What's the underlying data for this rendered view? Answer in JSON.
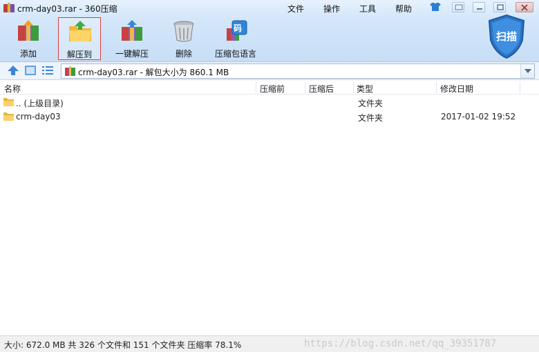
{
  "window": {
    "title": "crm-day03.rar - 360压缩"
  },
  "menu": [
    "文件",
    "操作",
    "工具",
    "帮助"
  ],
  "toolbar": {
    "items": [
      {
        "label": "添加",
        "icon": "add-archive-icon"
      },
      {
        "label": "解压到",
        "icon": "extract-to-icon",
        "selected": true
      },
      {
        "label": "一键解压",
        "icon": "one-click-extract-icon"
      },
      {
        "label": "删除",
        "icon": "trash-icon"
      },
      {
        "label": "压缩包语言",
        "icon": "archive-encoding-icon",
        "badge": "码"
      }
    ],
    "scan_label": "扫描"
  },
  "address": {
    "path": "crm-day03.rar - 解包大小为 860.1 MB"
  },
  "columns": [
    "名称",
    "压缩前",
    "压缩后",
    "类型",
    "修改日期"
  ],
  "rows": [
    {
      "name": ".. (上级目录)",
      "type": "文件夹",
      "date": ""
    },
    {
      "name": "crm-day03",
      "type": "文件夹",
      "date": "2017-01-02 19:52"
    }
  ],
  "status": {
    "text": "大小: 672.0 MB 共 326 个文件和 151 个文件夹 压缩率 78.1%",
    "watermark": "https://blog.csdn.net/qq_39351787"
  },
  "colors": {
    "accent": "#2a7fd4",
    "toolbar_bg": "#d4e7fa",
    "selection_border": "#e23c3c"
  }
}
